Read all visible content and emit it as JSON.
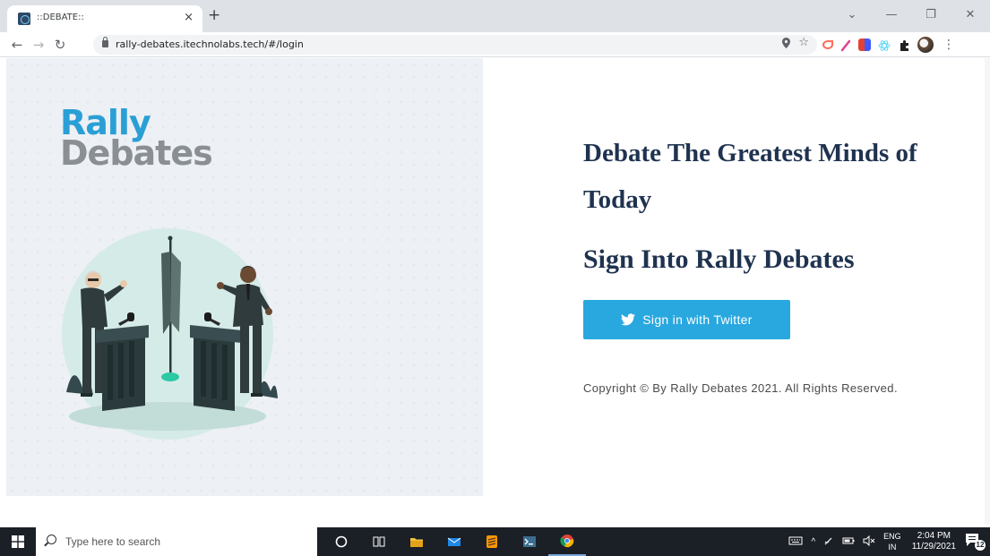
{
  "browser": {
    "tab_title": "::DEBATE::",
    "tab_close": "×",
    "new_tab": "+",
    "url": "rally-debates.itechnolabs.tech/#/login",
    "window_controls": [
      "⌄",
      "—",
      "❐",
      "✕"
    ]
  },
  "page": {
    "logo": {
      "line1": "Rally",
      "line2": "Debates"
    },
    "headline": "Debate The Greatest Minds of Today",
    "subhead": "Sign Into Rally Debates",
    "twitter_button": "Sign in with Twitter",
    "copyright": "Copyright © By Rally Debates 2021. All Rights Reserved."
  },
  "taskbar": {
    "search_placeholder": "Type here to search",
    "language": [
      "ENG",
      "IN"
    ],
    "time": "2:04 PM",
    "date": "11/29/2021",
    "notification_count": "12"
  },
  "colors": {
    "brand_blue": "#2a9fd6",
    "heading_navy": "#1f3350",
    "twitter_blue": "#29a8e0"
  }
}
